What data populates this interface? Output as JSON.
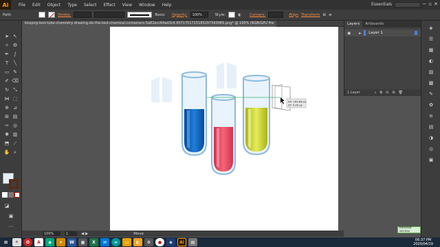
{
  "app": {
    "logo": "Ai",
    "workspace": "Essentials"
  },
  "menu": [
    "File",
    "Edit",
    "Object",
    "Type",
    "Select",
    "Effect",
    "View",
    "Window",
    "Help"
  ],
  "window_controls": [
    "−",
    "▫",
    "✕"
  ],
  "control_bar": {
    "selection": "Path",
    "stroke_label": "Stroke:",
    "brush_label": "Basic",
    "opacity_label": "Opacity:",
    "opacity_value": "100%",
    "style_label": "Style:",
    "corners_label": "Corners:",
    "align_label": "Align",
    "transform_label": "Transform"
  },
  "document_tab": "kisspng-test-tube-chemistry-drawing-do-the-test-chemical-containers-5a82ecc64ad3c4.9571751715185297343065.png* @ 100% (RGB/GPU Pre",
  "tooltip": {
    "line1": "dX: 169.88 px",
    "line2": "dY: 0.00 px"
  },
  "layers_panel": {
    "tabs": [
      "Layers",
      "Artboards"
    ],
    "layer_name": "Layer 1",
    "footer": "1 Layer"
  },
  "status_bar": {
    "zoom": "100%",
    "page": "1",
    "tool": "Move"
  },
  "colors": {
    "accent": "#ff8b3c",
    "layer_select": "#4a7fd8",
    "tube_blue": "#0e5fb8",
    "tube_red": "#e8445c",
    "tube_yellow": "#c9d41e",
    "glass": "#9cc6e6"
  },
  "taskbar": {
    "time": "06:37 PM",
    "date": "2020/04/19",
    "notice": "Internet access"
  }
}
